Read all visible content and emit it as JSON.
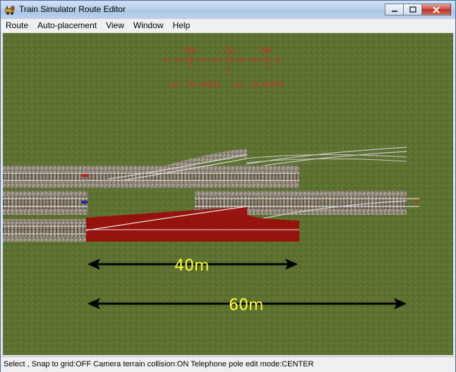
{
  "window": {
    "title": "Train Simulator Route Editor"
  },
  "menu": [
    "Route",
    "Auto-placement",
    "View",
    "Window",
    "Help"
  ],
  "compass": {
    "ticks": [
      "240",
      "270",
      "300"
    ],
    "lat_label": "Lat",
    "lat_value": "40.36832",
    "lon_label": "Lon",
    "lon_value": "10.62049"
  },
  "measurements": {
    "short": "40m",
    "long": "60m"
  },
  "status": "Select , Snap to grid:OFF Camera terrain collision:ON Telephone pole edit mode:CENTER",
  "colors": {
    "grass": "#5a6e2a",
    "compass": "#d03020",
    "measure_text": "#ffff33",
    "highlight": "#9b0a0a"
  }
}
